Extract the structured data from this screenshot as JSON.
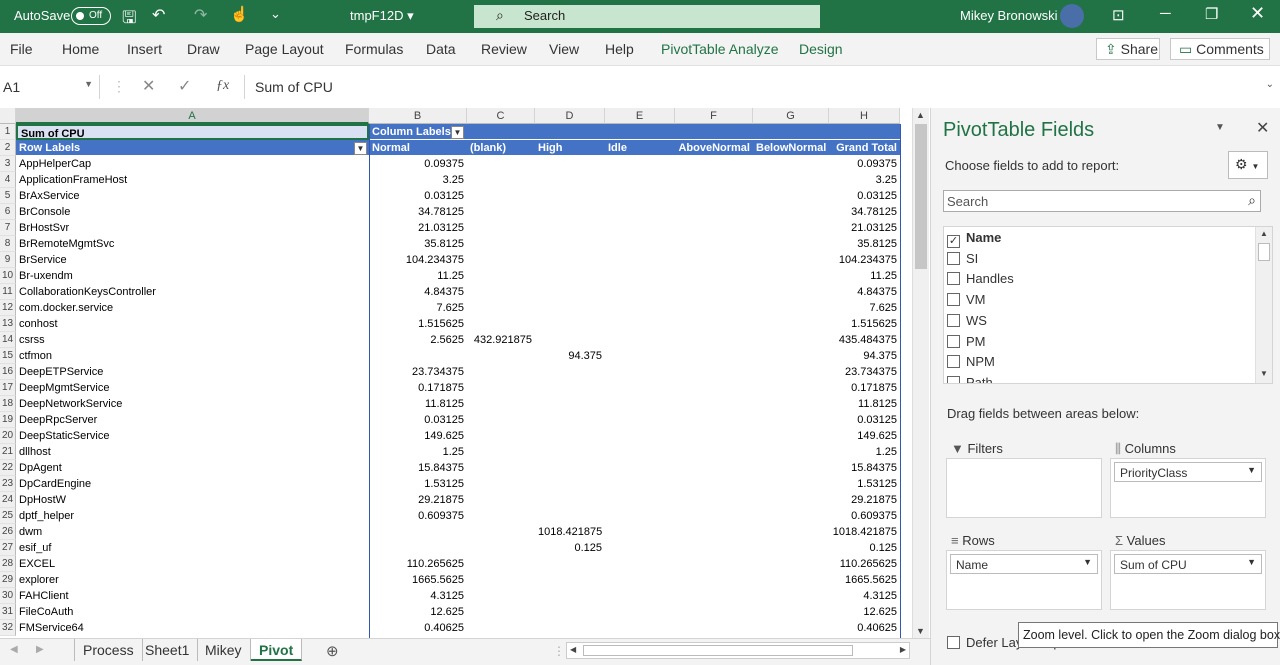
{
  "titlebar": {
    "autosave": "AutoSave",
    "toggle": "Off",
    "filename": "tmpF12D",
    "search": "Search",
    "user": "Mikey Bronowski"
  },
  "ribbon": {
    "tabs": [
      "File",
      "Home",
      "Insert",
      "Draw",
      "Page Layout",
      "Formulas",
      "Data",
      "Review",
      "View",
      "Help",
      "PivotTable Analyze",
      "Design"
    ],
    "share": "Share",
    "comments": "Comments"
  },
  "formula": {
    "namebox": "A1",
    "fx": "fx",
    "content": "Sum of CPU"
  },
  "columns": [
    "A",
    "B",
    "C",
    "D",
    "E",
    "F",
    "G",
    "H"
  ],
  "pivot": {
    "r1": {
      "a": "Sum of CPU",
      "b": "Column Labels"
    },
    "r2": {
      "a": "Row Labels",
      "b": "Normal",
      "c": "(blank)",
      "d": "High",
      "e": "Idle",
      "f": "AboveNormal",
      "g": "BelowNormal",
      "h": "Grand Total"
    },
    "rows": [
      {
        "n": "3",
        "a": "AppHelperCap",
        "b": "0.09375",
        "c": "",
        "d": "",
        "h": "0.09375"
      },
      {
        "n": "4",
        "a": "ApplicationFrameHost",
        "b": "3.25",
        "c": "",
        "d": "",
        "h": "3.25"
      },
      {
        "n": "5",
        "a": "BrAxService",
        "b": "0.03125",
        "c": "",
        "d": "",
        "h": "0.03125"
      },
      {
        "n": "6",
        "a": "BrConsole",
        "b": "34.78125",
        "c": "",
        "d": "",
        "h": "34.78125"
      },
      {
        "n": "7",
        "a": "BrHostSvr",
        "b": "21.03125",
        "c": "",
        "d": "",
        "h": "21.03125"
      },
      {
        "n": "8",
        "a": "BrRemoteMgmtSvc",
        "b": "35.8125",
        "c": "",
        "d": "",
        "h": "35.8125"
      },
      {
        "n": "9",
        "a": "BrService",
        "b": "104.234375",
        "c": "",
        "d": "",
        "h": "104.234375"
      },
      {
        "n": "10",
        "a": "Br-uxendm",
        "b": "11.25",
        "c": "",
        "d": "",
        "h": "11.25"
      },
      {
        "n": "11",
        "a": "CollaborationKeysController",
        "b": "4.84375",
        "c": "",
        "d": "",
        "h": "4.84375"
      },
      {
        "n": "12",
        "a": "com.docker.service",
        "b": "7.625",
        "c": "",
        "d": "",
        "h": "7.625"
      },
      {
        "n": "13",
        "a": "conhost",
        "b": "1.515625",
        "c": "",
        "d": "",
        "h": "1.515625"
      },
      {
        "n": "14",
        "a": "csrss",
        "b": "2.5625",
        "c": "432.921875",
        "d": "",
        "h": "435.484375"
      },
      {
        "n": "15",
        "a": "ctfmon",
        "b": "",
        "c": "",
        "d": "94.375",
        "h": "94.375"
      },
      {
        "n": "16",
        "a": "DeepETPService",
        "b": "23.734375",
        "c": "",
        "d": "",
        "h": "23.734375"
      },
      {
        "n": "17",
        "a": "DeepMgmtService",
        "b": "0.171875",
        "c": "",
        "d": "",
        "h": "0.171875"
      },
      {
        "n": "18",
        "a": "DeepNetworkService",
        "b": "11.8125",
        "c": "",
        "d": "",
        "h": "11.8125"
      },
      {
        "n": "19",
        "a": "DeepRpcServer",
        "b": "0.03125",
        "c": "",
        "d": "",
        "h": "0.03125"
      },
      {
        "n": "20",
        "a": "DeepStaticService",
        "b": "149.625",
        "c": "",
        "d": "",
        "h": "149.625"
      },
      {
        "n": "21",
        "a": "dllhost",
        "b": "1.25",
        "c": "",
        "d": "",
        "h": "1.25"
      },
      {
        "n": "22",
        "a": "DpAgent",
        "b": "15.84375",
        "c": "",
        "d": "",
        "h": "15.84375"
      },
      {
        "n": "23",
        "a": "DpCardEngine",
        "b": "1.53125",
        "c": "",
        "d": "",
        "h": "1.53125"
      },
      {
        "n": "24",
        "a": "DpHostW",
        "b": "29.21875",
        "c": "",
        "d": "",
        "h": "29.21875"
      },
      {
        "n": "25",
        "a": "dptf_helper",
        "b": "0.609375",
        "c": "",
        "d": "",
        "h": "0.609375"
      },
      {
        "n": "26",
        "a": "dwm",
        "b": "",
        "c": "",
        "d": "1018.421875",
        "h": "1018.421875"
      },
      {
        "n": "27",
        "a": "esif_uf",
        "b": "",
        "c": "",
        "d": "0.125",
        "h": "0.125"
      },
      {
        "n": "28",
        "a": "EXCEL",
        "b": "110.265625",
        "c": "",
        "d": "",
        "h": "110.265625"
      },
      {
        "n": "29",
        "a": "explorer",
        "b": "1665.5625",
        "c": "",
        "d": "",
        "h": "1665.5625"
      },
      {
        "n": "30",
        "a": "FAHClient",
        "b": "4.3125",
        "c": "",
        "d": "",
        "h": "4.3125"
      },
      {
        "n": "31",
        "a": "FileCoAuth",
        "b": "12.625",
        "c": "",
        "d": "",
        "h": "12.625"
      },
      {
        "n": "32",
        "a": "FMService64",
        "b": "0.40625",
        "c": "",
        "d": "",
        "h": "0.40625"
      }
    ]
  },
  "sheets": [
    "Process",
    "Sheet1",
    "Mikey",
    "Pivot"
  ],
  "pane": {
    "title": "PivotTable Fields",
    "sub": "Choose fields to add to report:",
    "search": "Search",
    "fields": [
      {
        "label": "Name",
        "checked": true
      },
      {
        "label": "SI",
        "checked": false
      },
      {
        "label": "Handles",
        "checked": false
      },
      {
        "label": "VM",
        "checked": false
      },
      {
        "label": "WS",
        "checked": false
      },
      {
        "label": "PM",
        "checked": false
      },
      {
        "label": "NPM",
        "checked": false
      },
      {
        "label": "Path",
        "checked": false
      }
    ],
    "drag": "Drag fields between areas below:",
    "filters": "Filters",
    "columns": "Columns",
    "rows": "Rows",
    "values": "Values",
    "columns_item": "PriorityClass",
    "rows_item": "Name",
    "values_item": "Sum of CPU",
    "defer": "Defer Layout Update"
  },
  "tooltip": "Zoom level. Click to open the Zoom dialog box."
}
